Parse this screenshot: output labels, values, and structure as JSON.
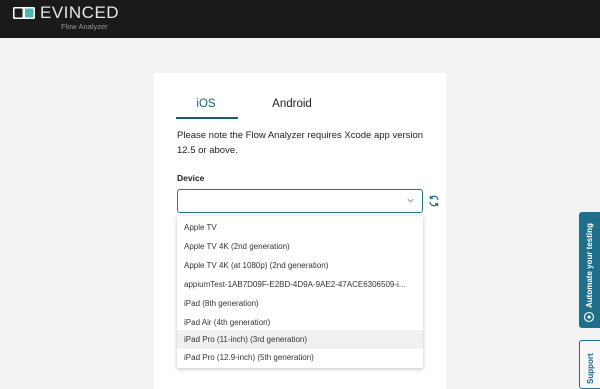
{
  "header": {
    "brand": "EVINCED",
    "subtitle": "Flow Analyzer",
    "colors": {
      "background": "#1a1a1a"
    }
  },
  "tabs": [
    {
      "label": "iOS",
      "active": true
    },
    {
      "label": "Android",
      "active": false
    }
  ],
  "note": "Please note the Flow Analyzer requires Xcode app version 12.5 or above.",
  "device": {
    "label": "Device",
    "value": "",
    "options": [
      "Apple TV",
      "Apple TV 4K (2nd generation)",
      "Apple TV 4K (at 1080p) (2nd generation)",
      "appiumTest-1AB7D09F-E2BD-4D9A-9AE2-47ACE6306509-i...",
      "iPad (8th generation)",
      "iPad Air (4th generation)",
      "iPad Pro (11-inch) (3rd generation)",
      "iPad Pro (12.9-inch) (5th generation)"
    ],
    "highlighted_index": 6
  },
  "side_buttons": {
    "automate": "Automate your testing",
    "support": "Support"
  },
  "icons": {
    "logo": "evinced-logo-icon",
    "chevron": "chevron-down-icon",
    "refresh": "refresh-icon",
    "automate": "automate-icon"
  },
  "accent_color": "#15606b"
}
